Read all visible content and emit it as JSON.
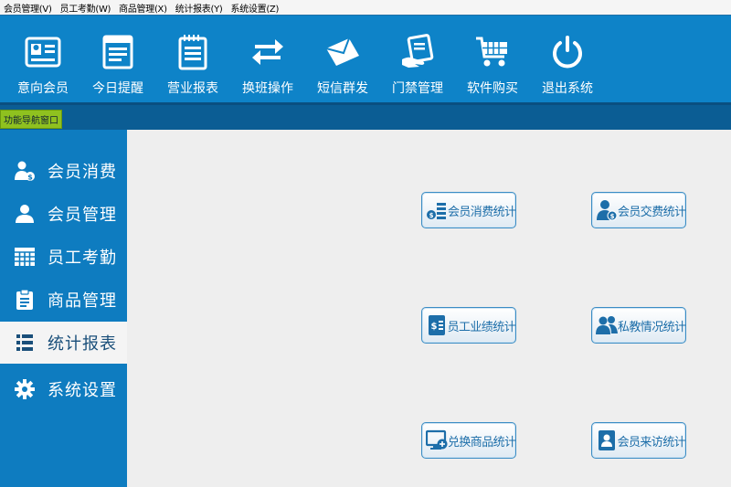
{
  "menu": [
    "会员管理(V)",
    "员工考勤(W)",
    "商品管理(X)",
    "统计报表(Y)",
    "系统设置(Z)"
  ],
  "toolbar": [
    {
      "label": "意向会员",
      "icon": "member-card-icon"
    },
    {
      "label": "今日提醒",
      "icon": "notepad-icon"
    },
    {
      "label": "营业报表",
      "icon": "report-icon"
    },
    {
      "label": "换班操作",
      "icon": "swap-icon"
    },
    {
      "label": "短信群发",
      "icon": "envelope-icon"
    },
    {
      "label": "门禁管理",
      "icon": "access-card-icon"
    },
    {
      "label": "软件购买",
      "icon": "shopping-cart-icon"
    },
    {
      "label": "退出系统",
      "icon": "power-icon"
    }
  ],
  "nav_tab": "功能导航窗口",
  "sidebar": [
    {
      "label": "会员消费",
      "icon": "user-money-icon"
    },
    {
      "label": "会员管理",
      "icon": "user-icon"
    },
    {
      "label": "员工考勤",
      "icon": "calendar-grid-icon"
    },
    {
      "label": "商品管理",
      "icon": "clipboard-icon"
    },
    {
      "label": "统计报表",
      "icon": "list-icon",
      "active": true
    },
    {
      "label": "系统设置",
      "icon": "gear-icon"
    }
  ],
  "reports": [
    {
      "label": "会员消费统计",
      "icon": "coins-chart-icon"
    },
    {
      "label": "会员交费统计",
      "icon": "user-payment-icon"
    },
    {
      "label": "员工业绩统计",
      "icon": "money-doc-icon"
    },
    {
      "label": "私教情况统计",
      "icon": "group-icon"
    },
    {
      "label": "兑换商品统计",
      "icon": "monitor-plus-icon"
    },
    {
      "label": "会员来访统计",
      "icon": "visitor-card-icon"
    }
  ],
  "colors": {
    "toolbar": "#0e83c8",
    "sidebar": "#0e7cc0",
    "nav_tab": "#8fc11f",
    "button_text": "#1d6ea9"
  }
}
